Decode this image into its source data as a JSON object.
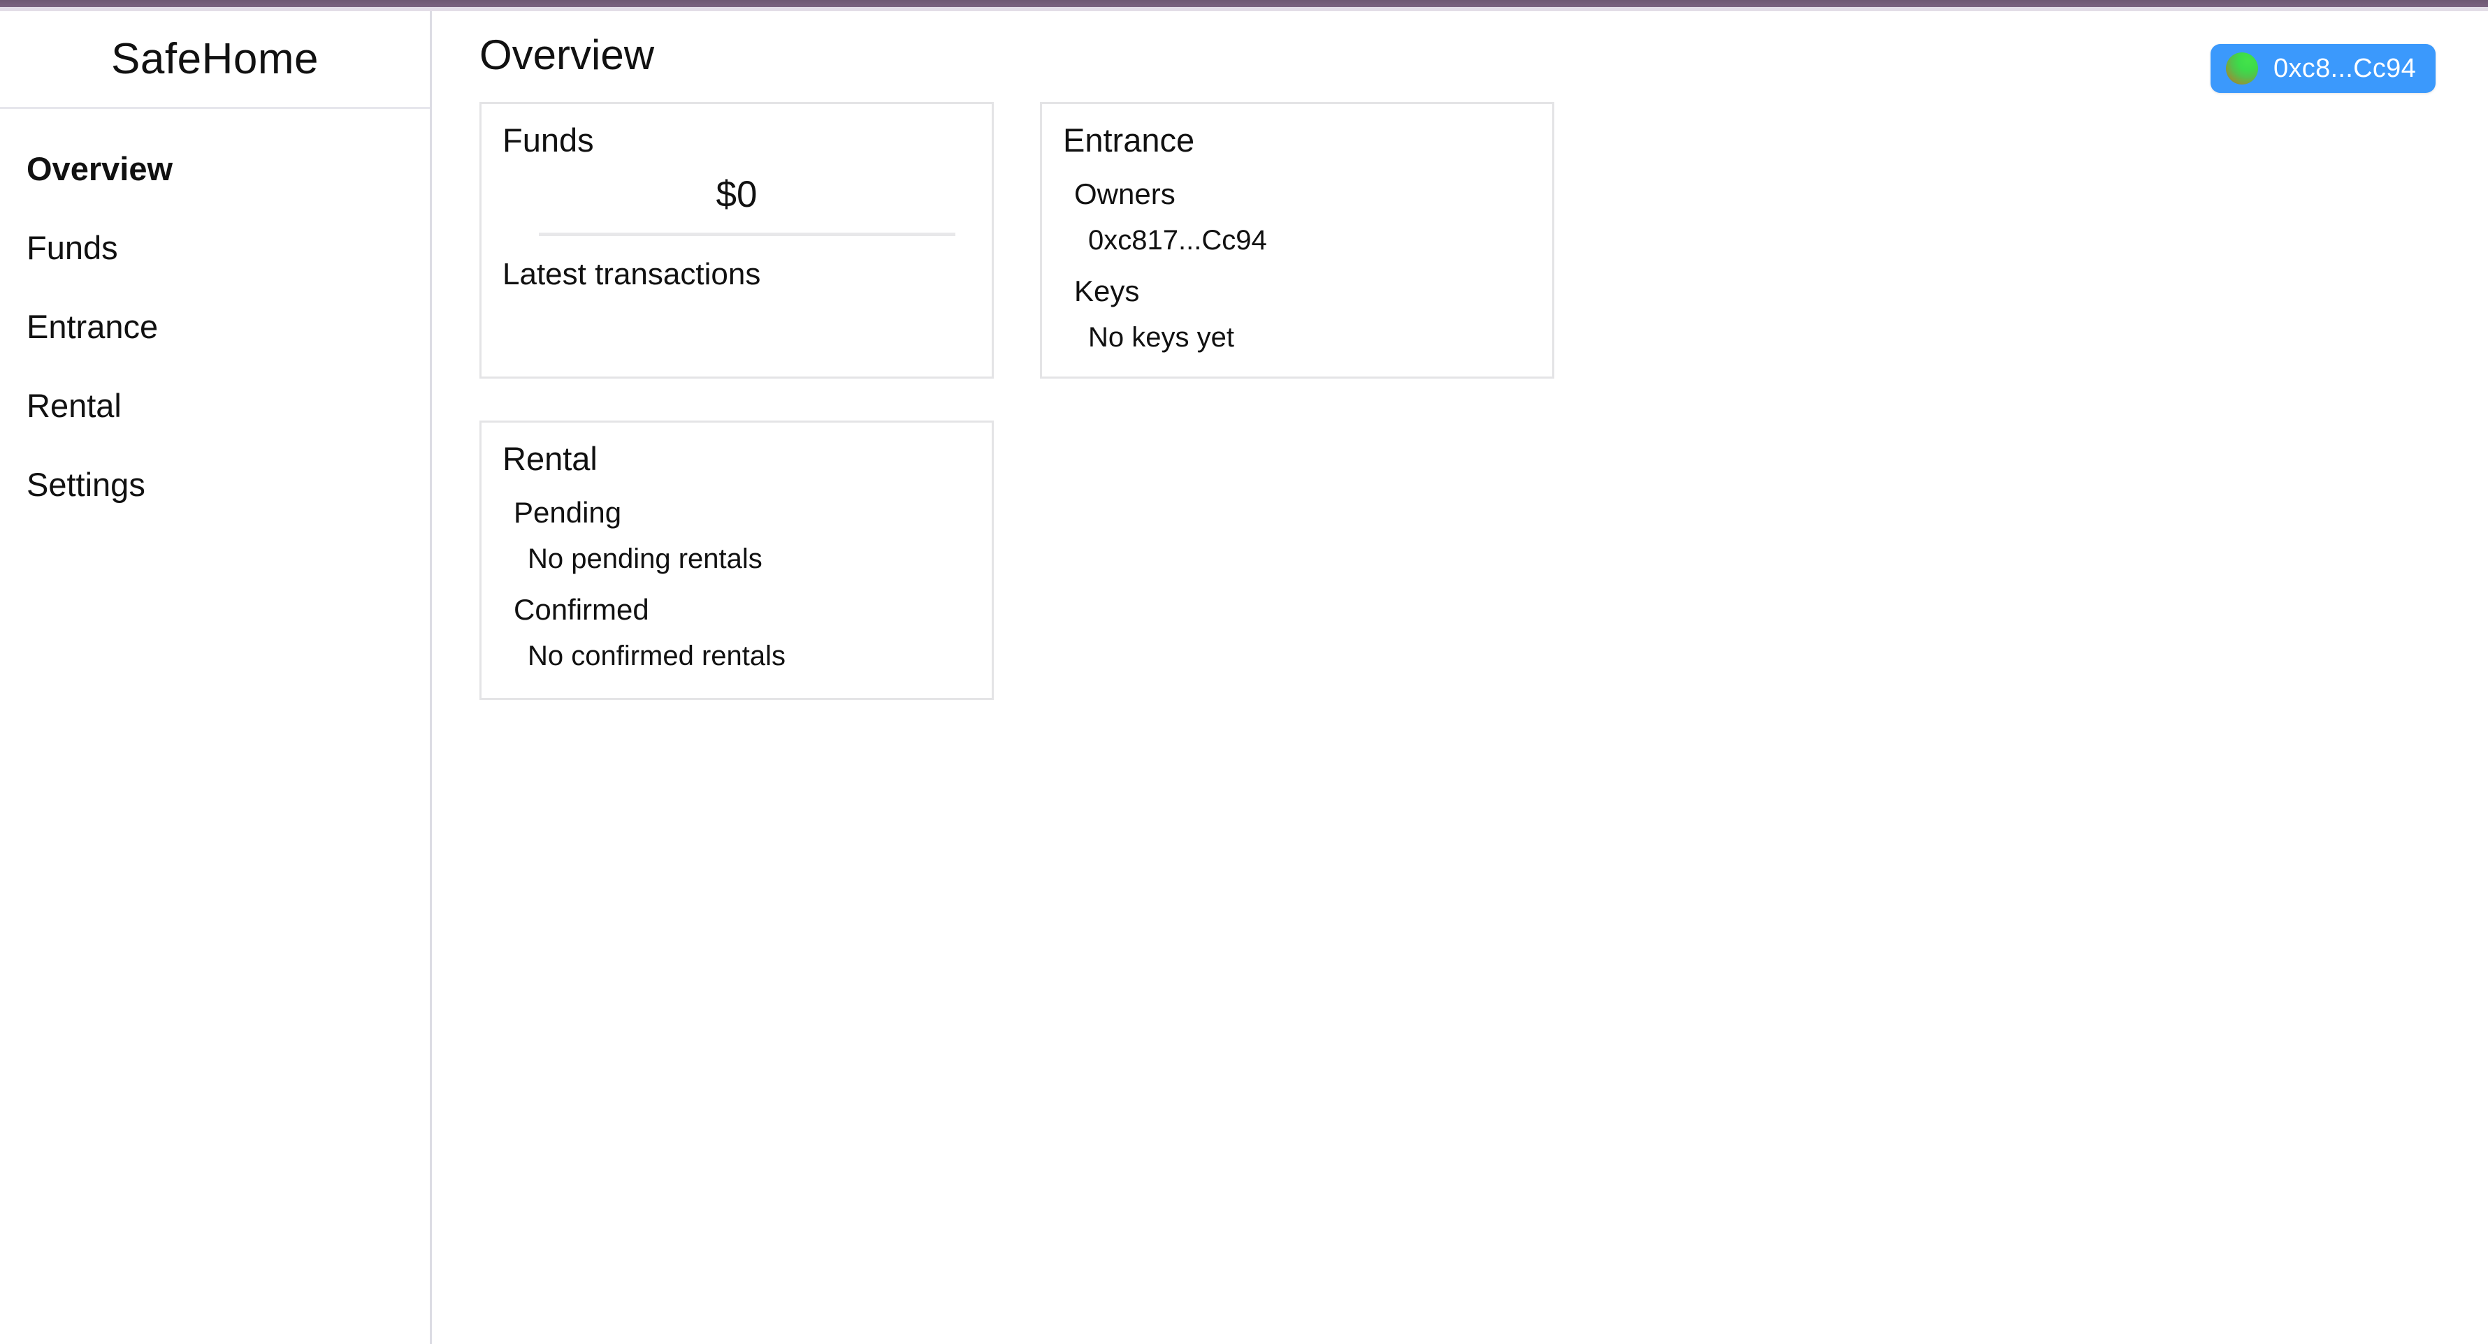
{
  "theme": {
    "accent_bar": "#6e5873",
    "accent_underline": "#e3dde7",
    "wallet_button_bg": "#3b99fc",
    "card_border": "#e4e4e6",
    "text": "#111111"
  },
  "sidebar": {
    "brand": "SafeHome",
    "items": [
      {
        "label": "Overview",
        "active": true
      },
      {
        "label": "Funds",
        "active": false
      },
      {
        "label": "Entrance",
        "active": false
      },
      {
        "label": "Rental",
        "active": false
      },
      {
        "label": "Settings",
        "active": false
      }
    ]
  },
  "header": {
    "title": "Overview",
    "wallet": {
      "address": "0xc8...Cc94",
      "avatar_icon": "wallet-avatar-blockie"
    }
  },
  "cards": {
    "funds": {
      "title": "Funds",
      "balance": "$0",
      "transactions_label": "Latest transactions",
      "transactions": []
    },
    "entrance": {
      "title": "Entrance",
      "owners_label": "Owners",
      "owners": [
        "0xc817...Cc94"
      ],
      "keys_label": "Keys",
      "keys_empty": "No keys yet"
    },
    "rental": {
      "title": "Rental",
      "pending_label": "Pending",
      "pending_empty": "No pending rentals",
      "confirmed_label": "Confirmed",
      "confirmed_empty": "No confirmed rentals"
    }
  }
}
